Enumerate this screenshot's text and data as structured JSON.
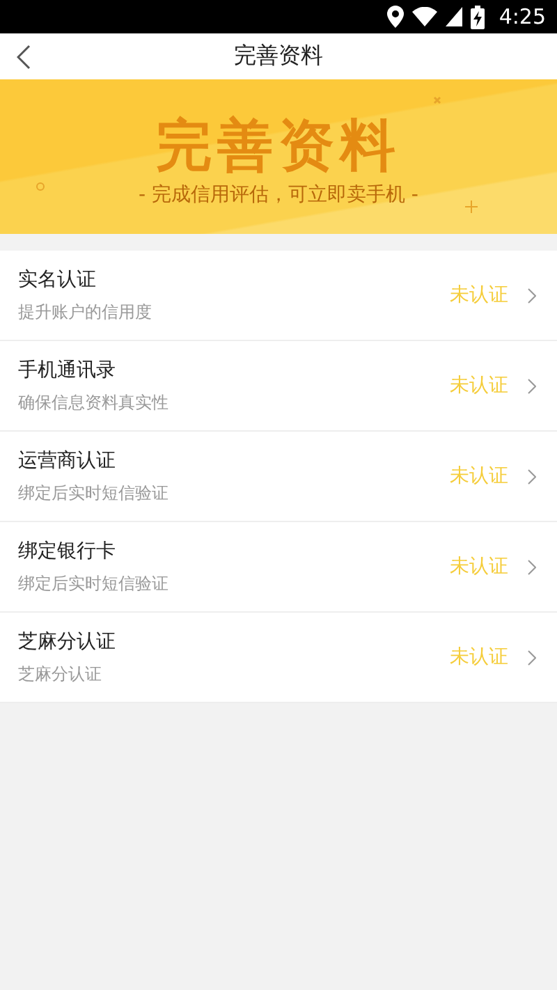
{
  "status_bar": {
    "time": "4:25"
  },
  "nav": {
    "title": "完善资料"
  },
  "banner": {
    "title": "完善资料",
    "subtitle": "- 完成信用评估，可立即卖手机 -"
  },
  "items": [
    {
      "title": "实名认证",
      "subtitle": "提升账户的信用度",
      "status": "未认证"
    },
    {
      "title": "手机通讯录",
      "subtitle": "确保信息资料真实性",
      "status": "未认证"
    },
    {
      "title": "运营商认证",
      "subtitle": "绑定后实时短信验证",
      "status": "未认证"
    },
    {
      "title": "绑定银行卡",
      "subtitle": "绑定后实时短信验证",
      "status": "未认证"
    },
    {
      "title": "芝麻分认证",
      "subtitle": "芝麻分认证",
      "status": "未认证"
    }
  ]
}
